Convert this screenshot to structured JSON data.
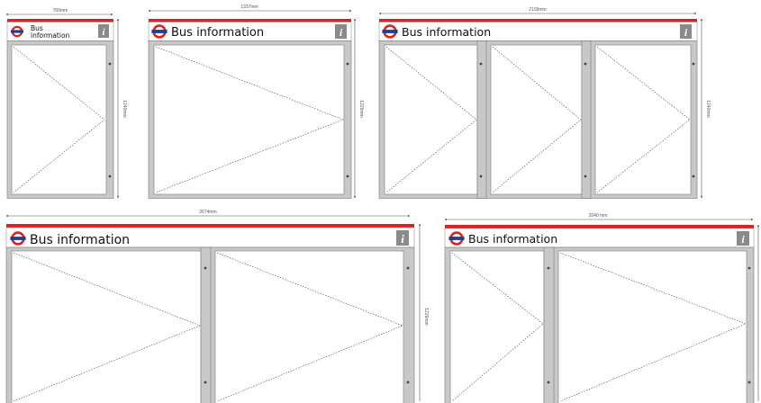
{
  "header": {
    "title": "Bus information",
    "title_small_line1": "Bus",
    "title_small_line2": "information",
    "info_glyph": "i",
    "logo_icon": "roundel-icon",
    "info_icon": "info-icon"
  },
  "colors": {
    "red_stripe": "#e0201f",
    "roundel_red": "#dc241f",
    "roundel_bar": "#1b3f94",
    "frame_grey": "#c8c8c8",
    "frame_dark": "#777777",
    "info_grey": "#8a8a8a"
  },
  "dimensions": {
    "d1_width": "700mm",
    "d1_height": "1240mm",
    "d2_width": "1337mm",
    "d2_height": "1226mm",
    "d3_width": "2109mm",
    "d3_height": "1240mm",
    "d4_width": "2674mm",
    "d4_height": "1226mm",
    "d5_width": "2040 mm"
  }
}
